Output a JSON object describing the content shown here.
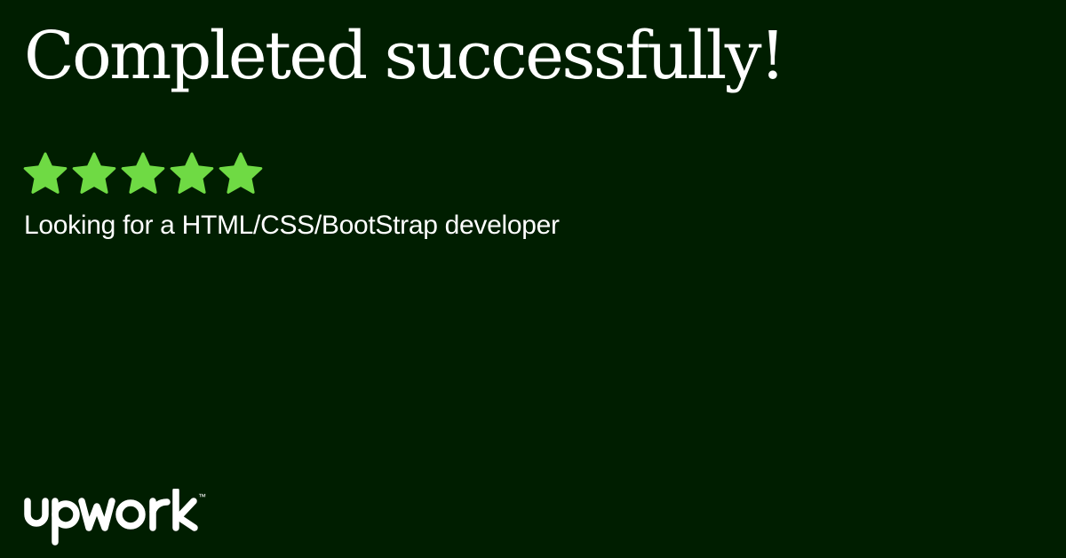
{
  "card": {
    "headline": "Completed successfully!",
    "rating": {
      "value": 5,
      "max": 5,
      "icon": "star-icon",
      "color": "#6fda44"
    },
    "job_title": "Looking for a HTML/CSS/BootStrap developer",
    "brand": {
      "wordmark": "upwork",
      "trademark": "™",
      "icon": "upwork-logo"
    }
  },
  "colors": {
    "background": "#001e00",
    "text": "#ffffff",
    "accent": "#6fda44"
  }
}
